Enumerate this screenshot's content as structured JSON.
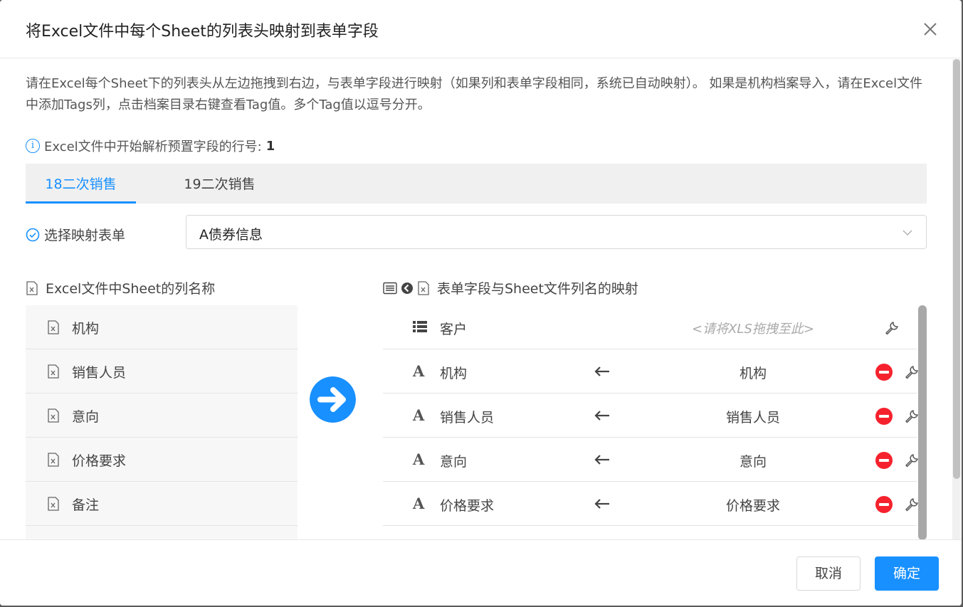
{
  "dialog": {
    "title": "将Excel文件中每个Sheet的列表头映射到表单字段",
    "description": "请在Excel每个Sheet下的列表头从左边拖拽到右边，与表单字段进行映射（如果列和表单字段相同，系统已自动映射）。 如果是机构档案导入，请在Excel文件中添加Tags列，点击档案目录右键查看Tag值。多个Tag值以逗号分开。",
    "start_row_label": "Excel文件中开始解析预置字段的行号:",
    "start_row_value": "1",
    "tabs": [
      {
        "label": "18二次销售",
        "active": true
      },
      {
        "label": "19二次销售",
        "active": false
      }
    ],
    "select_form_label": "选择映射表单",
    "select_form_value": "A债券信息",
    "left_section_title": "Excel文件中Sheet的列名称",
    "right_section_title": "表单字段与Sheet文件列名的映射",
    "left_columns": [
      "机构",
      "销售人员",
      "意向",
      "价格要求",
      "备注"
    ],
    "right_header": {
      "field": "客户",
      "placeholder": "<请将XLS拖拽至此>"
    },
    "mappings": [
      {
        "field": "机构",
        "type_icon": "A",
        "mapped": "机构"
      },
      {
        "field": "销售人员",
        "type_icon": "A",
        "mapped": "销售人员"
      },
      {
        "field": "意向",
        "type_icon": "A",
        "mapped": "意向"
      },
      {
        "field": "价格要求",
        "type_icon": "A",
        "mapped": "价格要求"
      }
    ],
    "cancel_label": "取消",
    "ok_label": "确定",
    "colors": {
      "primary": "#1890ff",
      "danger": "#f5222d"
    }
  }
}
